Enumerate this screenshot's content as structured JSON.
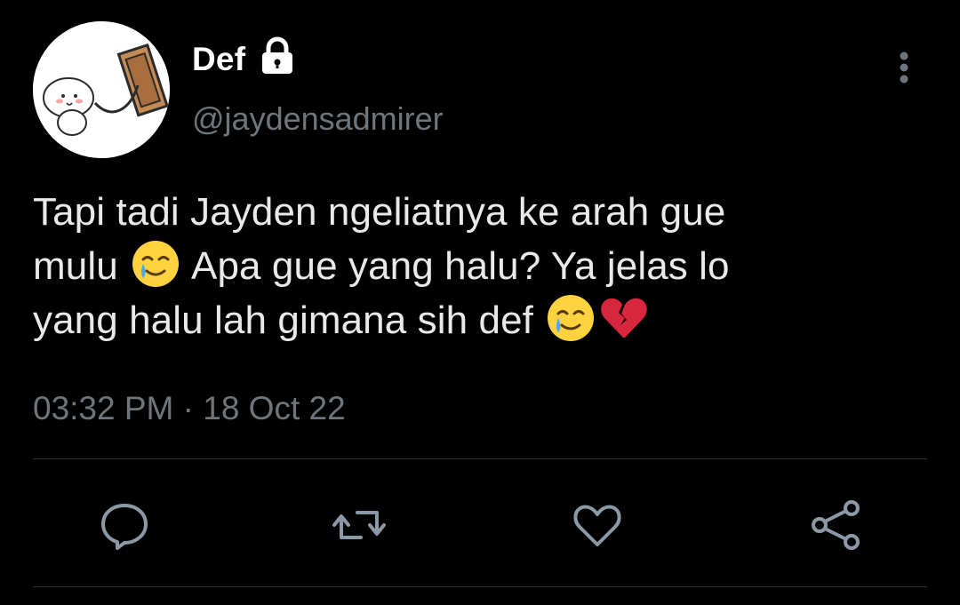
{
  "user": {
    "display_name": "Def",
    "handle": "@jaydensadmirer",
    "protected_icon": "lock-icon",
    "avatar": "avatar-cartoon-image"
  },
  "tweet": {
    "lines": [
      "Tapi tadi Jayden ngeliatnya ke arah gue",
      "mulu",
      "Apa gue yang halu? Ya jelas lo",
      "yang halu lah gimana sih def"
    ],
    "emojis": [
      "smiling-face-with-tear-emoji",
      "smiling-face-with-tear-emoji",
      "broken-heart-emoji"
    ],
    "timestamp": "03:32 PM · 18 Oct 22"
  },
  "actions": {
    "reply": "reply-icon",
    "retweet": "retweet-icon",
    "like": "like-icon",
    "share": "share-icon"
  },
  "menu": {
    "more": "more-options-icon"
  },
  "colors": {
    "background": "#000000",
    "text_primary": "#e7e9ea",
    "text_secondary": "#6e767d",
    "divider": "#2f3336",
    "emoji_yellow": "#ffd23f",
    "broken_heart": "#d7263d"
  }
}
